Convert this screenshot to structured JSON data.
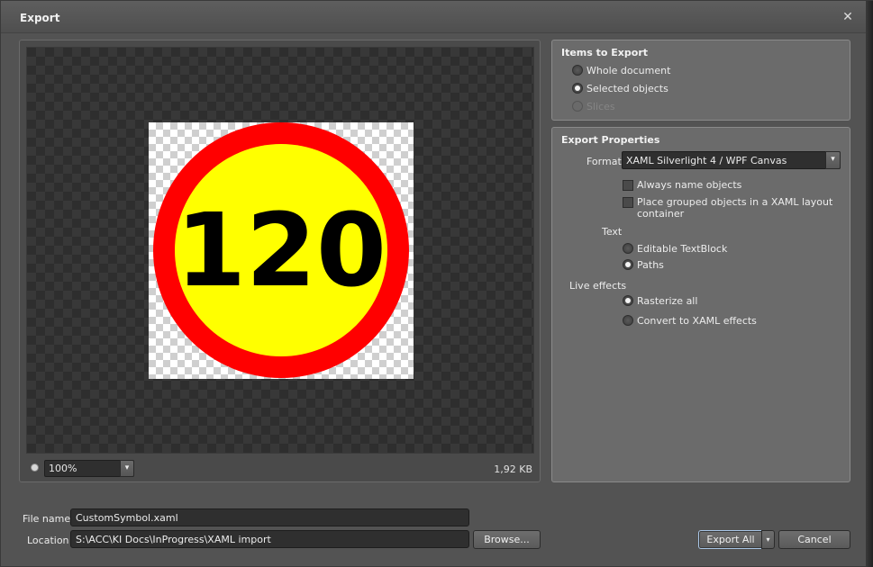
{
  "window": {
    "title": "Export",
    "close_glyph": "✕"
  },
  "preview": {
    "artwork_text": "120",
    "colors": {
      "ring": "#ff0000",
      "fill": "#ffff00",
      "text": "#000000"
    },
    "zoom": {
      "value": "100%",
      "dropdown_glyph": "▾"
    },
    "file_size": "1,92 KB"
  },
  "items_to_export": {
    "title": "Items to Export",
    "options": [
      {
        "label": "Whole document",
        "checked": false,
        "enabled": true
      },
      {
        "label": "Selected objects",
        "checked": true,
        "enabled": true
      },
      {
        "label": "Slices",
        "checked": false,
        "enabled": false
      }
    ]
  },
  "export_properties": {
    "title": "Export Properties",
    "format_label": "Format",
    "format_value": "XAML Silverlight 4 / WPF Canvas",
    "format_dropdown_glyph": "▾",
    "always_name_objects": "Always name objects",
    "place_grouped_line1": "Place grouped objects in a XAML layout",
    "place_grouped_line2": "container",
    "text_label": "Text",
    "text_options": [
      {
        "label": "Editable TextBlock",
        "checked": false
      },
      {
        "label": "Paths",
        "checked": true
      }
    ],
    "live_effects_label": "Live effects",
    "live_effects_options": [
      {
        "label": "Rasterize all",
        "checked": true
      },
      {
        "label": "Convert to XAML effects",
        "checked": false
      }
    ]
  },
  "file": {
    "name_label": "File name",
    "name_value": "CustomSymbol.xaml",
    "location_label": "Location",
    "location_value": "S:\\ACC\\KI Docs\\InProgress\\XAML import",
    "browse_label": "Browse..."
  },
  "buttons": {
    "export_all": "Export All",
    "export_all_dropdown_glyph": "▾",
    "cancel": "Cancel"
  }
}
